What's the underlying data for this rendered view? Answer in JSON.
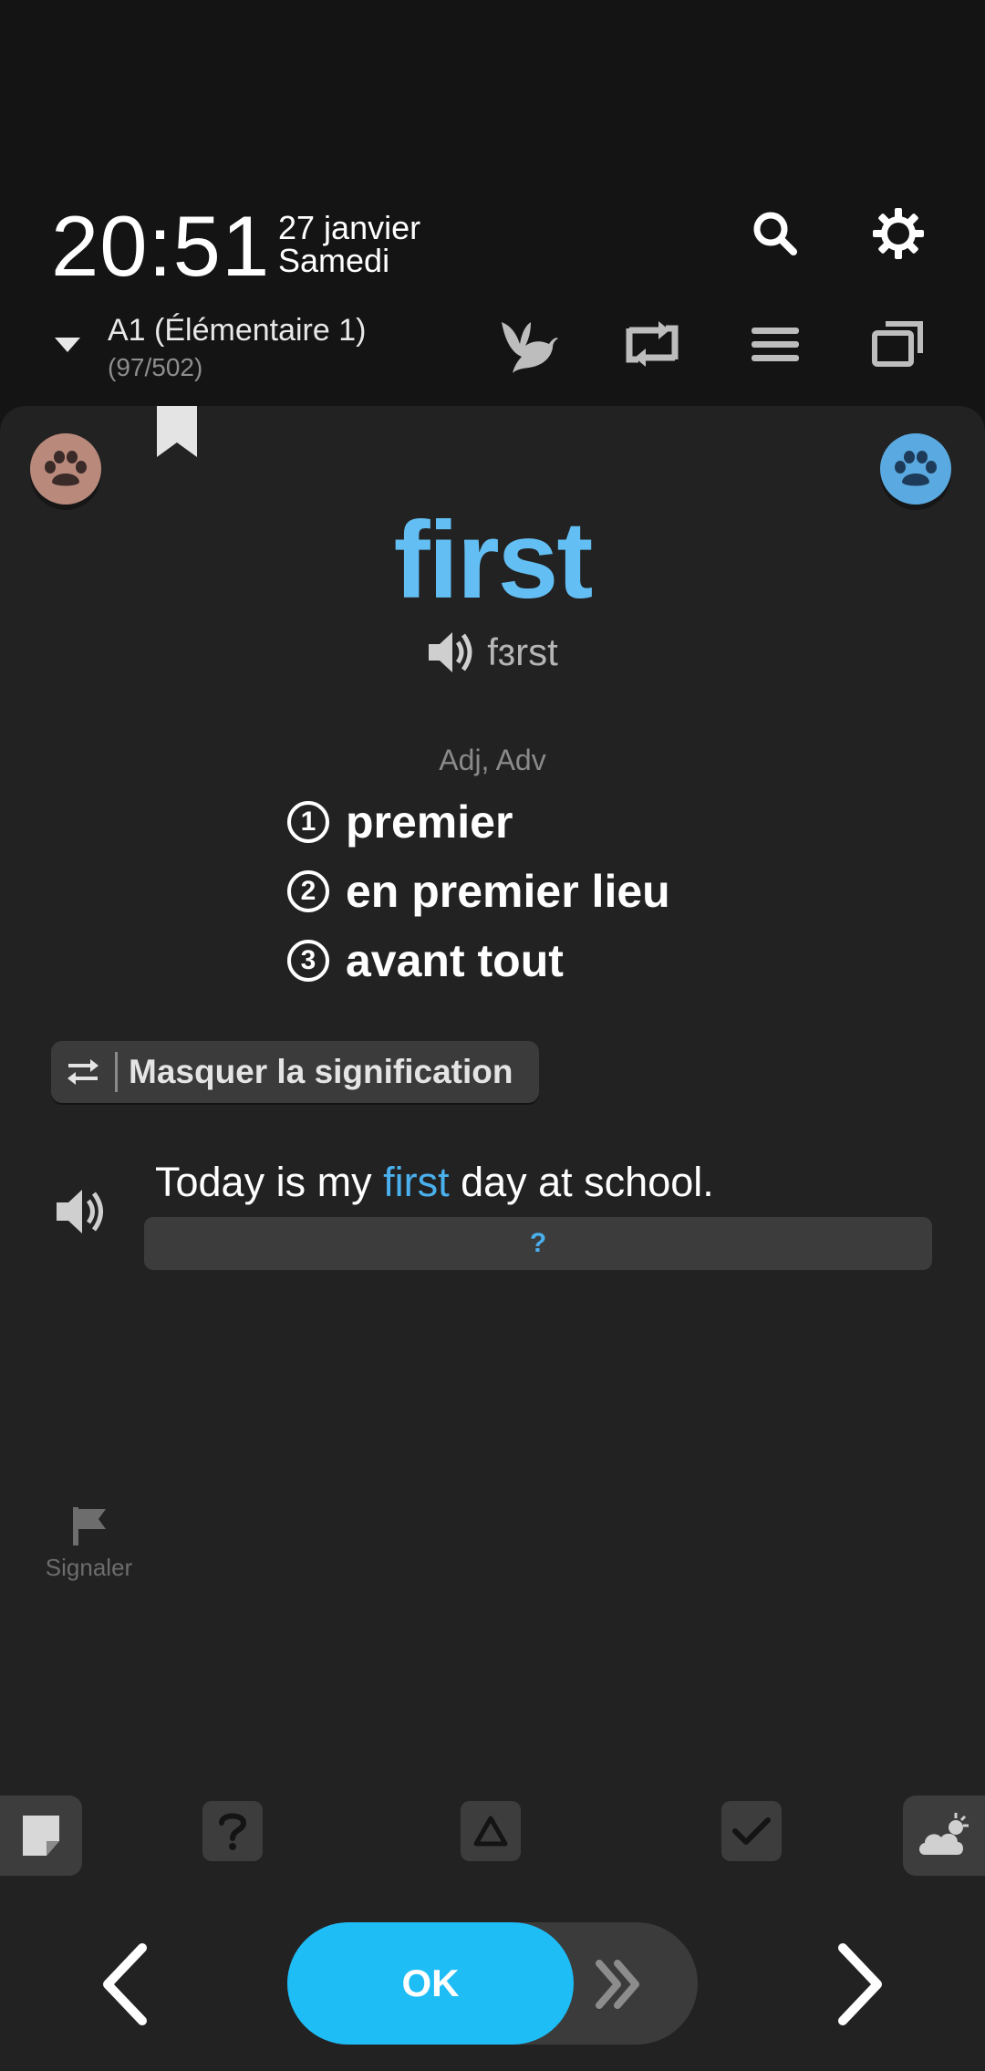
{
  "header": {
    "time": "20:51",
    "date_line1": "27 janvier",
    "date_line2": "Samedi",
    "level_name": "A1 (Élémentaire 1)",
    "level_count": "(97/502)"
  },
  "card": {
    "word": "first",
    "pronunciation": "fɜrst",
    "part_of_speech": "Adj, Adv",
    "meanings": [
      {
        "num": "1",
        "text": "premier"
      },
      {
        "num": "2",
        "text": "en premier lieu"
      },
      {
        "num": "3",
        "text": "avant tout"
      }
    ],
    "toggle_label": "Masquer la signification",
    "example": {
      "before": "Today is my ",
      "highlight": "first",
      "after": " day at school."
    },
    "reveal_label": "?",
    "report_label": "Signaler"
  },
  "bottom": {
    "ok_label": "OK"
  },
  "colors": {
    "accent": "#1ebdf6",
    "word": "#63bff3",
    "background": "#141414",
    "card": "#222222"
  }
}
